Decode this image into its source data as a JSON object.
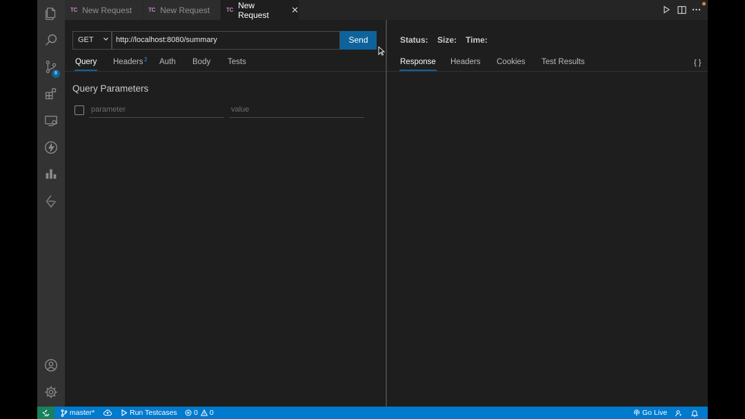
{
  "tabs": [
    {
      "icon": "TC",
      "label": "New Request",
      "active": false
    },
    {
      "icon": "TC",
      "label": "New Request",
      "active": false
    },
    {
      "icon": "TC",
      "label": "New Request",
      "active": true
    }
  ],
  "tab_close": "✕",
  "activity": {
    "source_control_badge": "8"
  },
  "request": {
    "method": "GET",
    "url": "http://localhost:8080/summary",
    "send_label": "Send",
    "tabs": {
      "query": "Query",
      "headers": "Headers",
      "headers_count": "2",
      "auth": "Auth",
      "body": "Body",
      "tests": "Tests"
    },
    "query_title": "Query Parameters",
    "param_placeholder": "parameter",
    "value_placeholder": "value"
  },
  "response": {
    "status_label": "Status:",
    "size_label": "Size:",
    "time_label": "Time:",
    "tabs": {
      "response": "Response",
      "headers": "Headers",
      "cookies": "Cookies",
      "test_results": "Test Results"
    },
    "format_button": "{ }"
  },
  "statusbar": {
    "branch": "master*",
    "run_testcases": "Run Testcases",
    "errors": "0",
    "warnings": "0",
    "go_live": "Go Live"
  },
  "colors": {
    "accent": "#0e639c",
    "statusbar": "#007acc",
    "remote": "#16825d"
  }
}
